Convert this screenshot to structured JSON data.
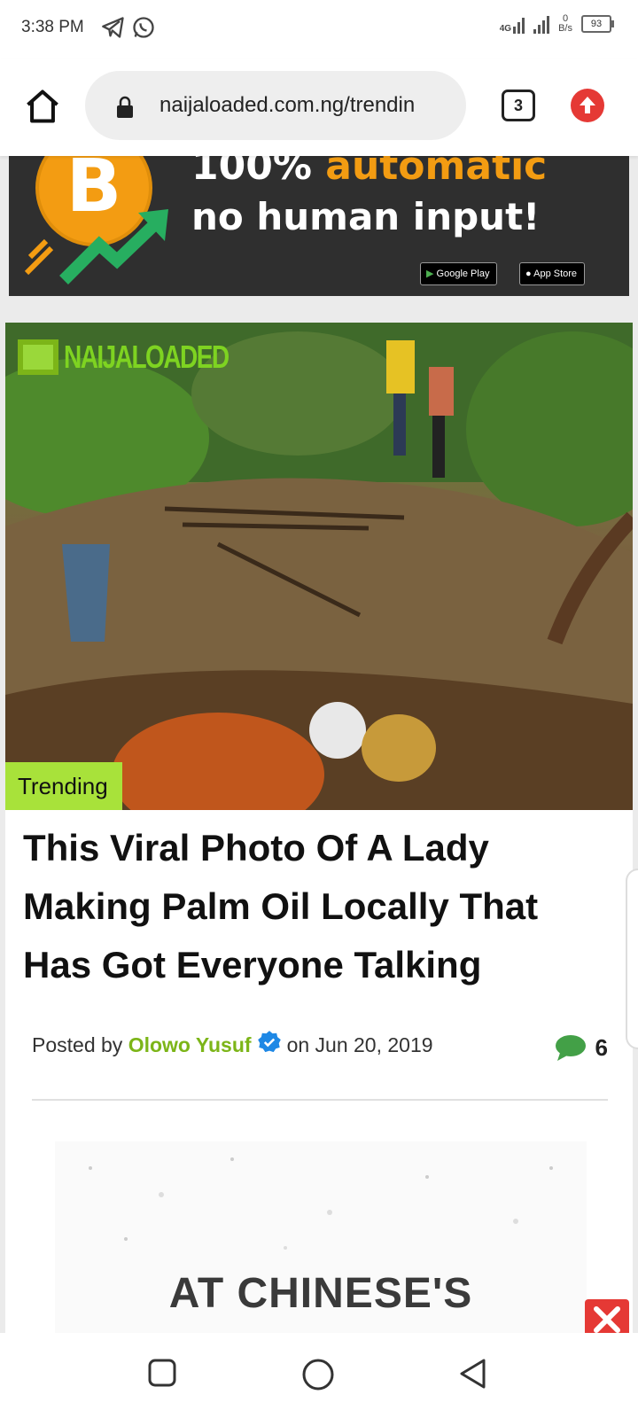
{
  "status_bar": {
    "time": "3:38 PM",
    "network": "4G",
    "speed_value": "0",
    "speed_unit": "B/s",
    "battery": "93"
  },
  "browser": {
    "url": "naijaloaded.com.ng/trendin",
    "tab_count": "3"
  },
  "ad": {
    "line1_prefix": "100% ",
    "line1_highlight": "automatic",
    "line2": "no human input!",
    "google_play": "Google Play",
    "app_store": "App Store",
    "coin_symbol": "B",
    "accent_color": "#f39c12"
  },
  "article": {
    "hero_logo_text": "NAIJALOADED",
    "category": "Trending",
    "title": "This Viral Photo Of A Lady Making Palm Oil Locally That Has Got Everyone Talking",
    "posted_by_label": "Posted by",
    "author": "Olowo Yusuf",
    "date_prefix": "on",
    "date": "Jun 20, 2019",
    "comment_count": "6",
    "embedded_image_text": "AT CHINESE'S",
    "accent_color": "#a8e23a"
  },
  "nav": {
    "recents": "recents",
    "home": "home",
    "back": "back"
  }
}
